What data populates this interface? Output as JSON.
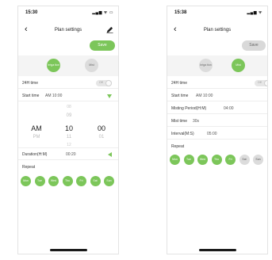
{
  "screens": [
    {
      "status_time": "15:30",
      "status_sys": "▂▄▆ ᯤ ▭",
      "back_glyph": "‹",
      "title": "Plan settings",
      "save_label": "Save",
      "modes": [
        {
          "label": "Irriga tion",
          "active": true
        },
        {
          "label": "Mist",
          "active": false
        }
      ],
      "rows": {
        "h24_label": "24H time",
        "h24_toggle": "Off",
        "start_label": "Start time",
        "start_value": "AM 10:00"
      },
      "picker": {
        "ampm": [
          "AM",
          "PM"
        ],
        "hours": [
          "08",
          "09",
          "10",
          "11",
          "12"
        ],
        "minutes": [
          "00",
          "01"
        ]
      },
      "duration_label": "Duration(H:M)",
      "duration_value": "00:20",
      "repeat_label": "Repeat",
      "days": [
        "Mon",
        "Tue",
        "Wed",
        "Thu",
        "Fri",
        "Sat",
        "Sun"
      ],
      "days_active": [
        true,
        true,
        true,
        true,
        true,
        true,
        true
      ]
    },
    {
      "status_time": "15:38",
      "status_sys": "▂▄▆ ᯤ",
      "back_glyph": "‹",
      "title": "Plan settings",
      "save_label": "Save",
      "modes": [
        {
          "label": "Irriga tion",
          "active": false
        },
        {
          "label": "Mist",
          "active": true
        }
      ],
      "rows": {
        "h24_label": "24H time",
        "h24_toggle": "Off",
        "start_label": "Start time",
        "start_value": "AM 10:00"
      },
      "misting_label": "Misting Period(H:M)",
      "misting_value": "04:00",
      "mist_time_label": "Mist time",
      "mist_time_value": "30s",
      "interval_label": "Interval(M:S)",
      "interval_value": "05:00",
      "repeat_label": "Repeat",
      "days": [
        "Mon",
        "Tue",
        "Wed",
        "Thu",
        "Fri",
        "Sat",
        "Sun"
      ],
      "days_active": [
        true,
        true,
        true,
        true,
        true,
        false,
        false
      ]
    }
  ],
  "colors": {
    "accent_green": "#7cc65a",
    "inactive_grey": "#dcdcdc",
    "save_active": "#7cc65a",
    "save_inactive": "#d9d9d9"
  }
}
